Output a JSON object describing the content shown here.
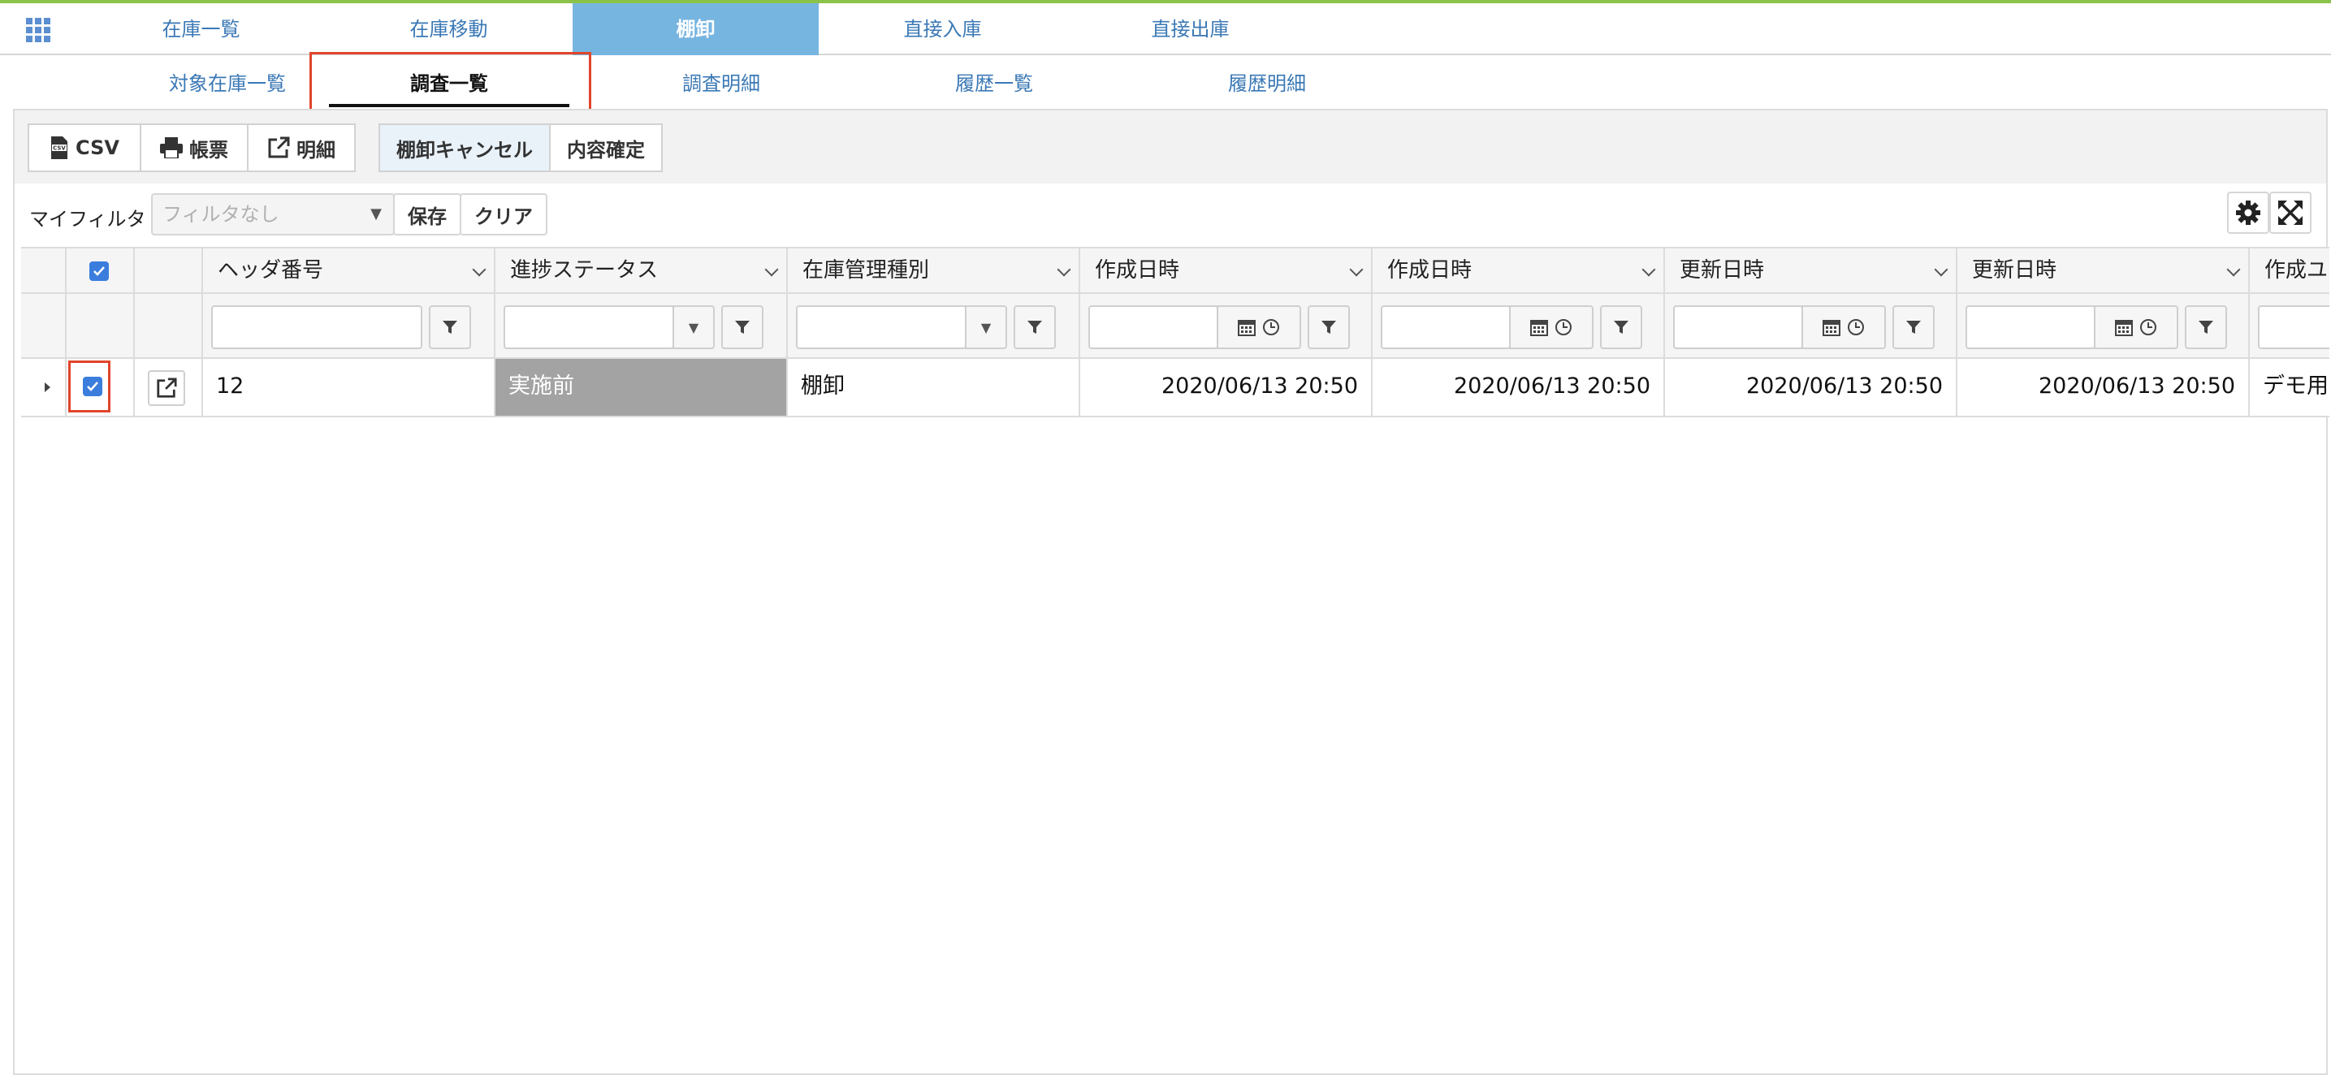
{
  "main_tabs": [
    "在庫一覧",
    "在庫移動",
    "棚卸",
    "直接入庫",
    "直接出庫"
  ],
  "main_tabs_active": "棚卸",
  "sub_tabs": [
    "対象在庫一覧",
    "調査一覧",
    "調査明細",
    "履歴一覧",
    "履歴明細"
  ],
  "sub_tabs_active": "調査一覧",
  "toolbar": {
    "csv": "CSV",
    "report": "帳票",
    "detail": "明細",
    "cancel_inventory": "棚卸キャンセル",
    "confirm_content": "内容確定"
  },
  "filter": {
    "label": "マイフィルタ",
    "placeholder": "フィルタなし",
    "save": "保存",
    "clear": "クリア"
  },
  "columns": [
    "ヘッダ番号",
    "進捗ステータス",
    "在庫管理種別",
    "作成日時",
    "作成日時",
    "更新日時",
    "更新日時",
    "作成ユ"
  ],
  "rows": [
    {
      "checked": true,
      "header_no": "12",
      "status": "実施前",
      "stock_type": "棚卸",
      "created_from": "2020/06/13 20:50",
      "created_to": "2020/06/13 20:50",
      "updated_from": "2020/06/13 20:50",
      "updated_to": "2020/06/13 20:50",
      "creator": "デモ用…"
    }
  ],
  "colors": {
    "accent": "#77b5e1",
    "link": "#3a78b5",
    "checkbox": "#3b7ddd",
    "highlight": "#e0452b",
    "status_bg": "#a3a3a3"
  }
}
